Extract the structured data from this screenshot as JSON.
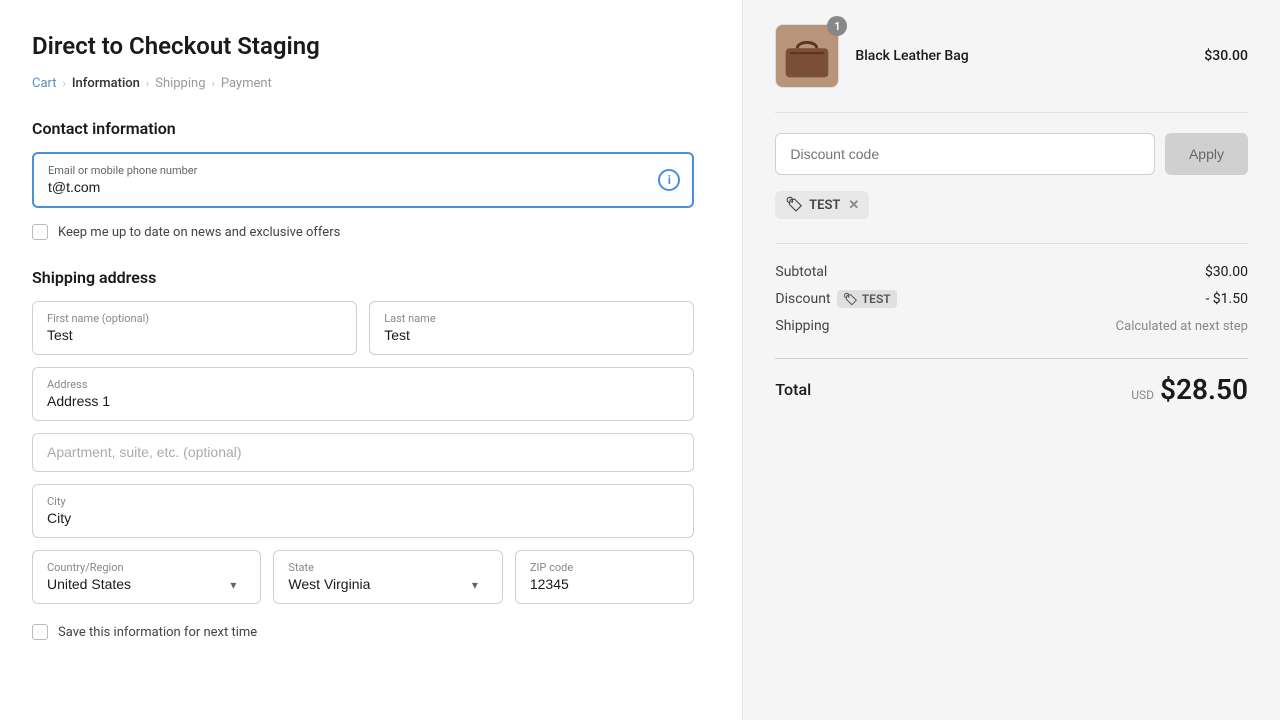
{
  "page": {
    "title": "Direct to Checkout Staging"
  },
  "breadcrumb": {
    "items": [
      {
        "label": "Cart",
        "active": false
      },
      {
        "label": "Information",
        "active": true
      },
      {
        "label": "Shipping",
        "active": false
      },
      {
        "label": "Payment",
        "active": false
      }
    ]
  },
  "contact": {
    "section_title": "Contact information",
    "email_label": "Email or mobile phone number",
    "email_value": "t@t.com",
    "newsletter_label": "Keep me up to date on news and exclusive offers"
  },
  "shipping": {
    "section_title": "Shipping address",
    "first_name_label": "First name (optional)",
    "first_name_value": "Test",
    "last_name_label": "Last name",
    "last_name_value": "Test",
    "address_label": "Address",
    "address_value": "Address 1",
    "apartment_placeholder": "Apartment, suite, etc. (optional)",
    "city_label": "City",
    "city_value": "City",
    "country_label": "Country/Region",
    "country_value": "United States",
    "state_label": "State",
    "state_value": "West Virginia",
    "zip_label": "ZIP code",
    "zip_value": "12345",
    "save_info_label": "Save this information for next time"
  },
  "order_summary": {
    "product": {
      "name": "Black Leather Bag",
      "price": "$30.00",
      "quantity": 1
    },
    "discount_placeholder": "Discount code",
    "apply_label": "Apply",
    "discount_code": "TEST",
    "subtotal_label": "Subtotal",
    "subtotal_value": "$30.00",
    "discount_label": "Discount",
    "discount_tag": "TEST",
    "discount_value": "- $1.50",
    "shipping_label": "Shipping",
    "shipping_value": "Calculated at next step",
    "total_label": "Total",
    "total_currency": "USD",
    "total_amount": "$28.50"
  }
}
